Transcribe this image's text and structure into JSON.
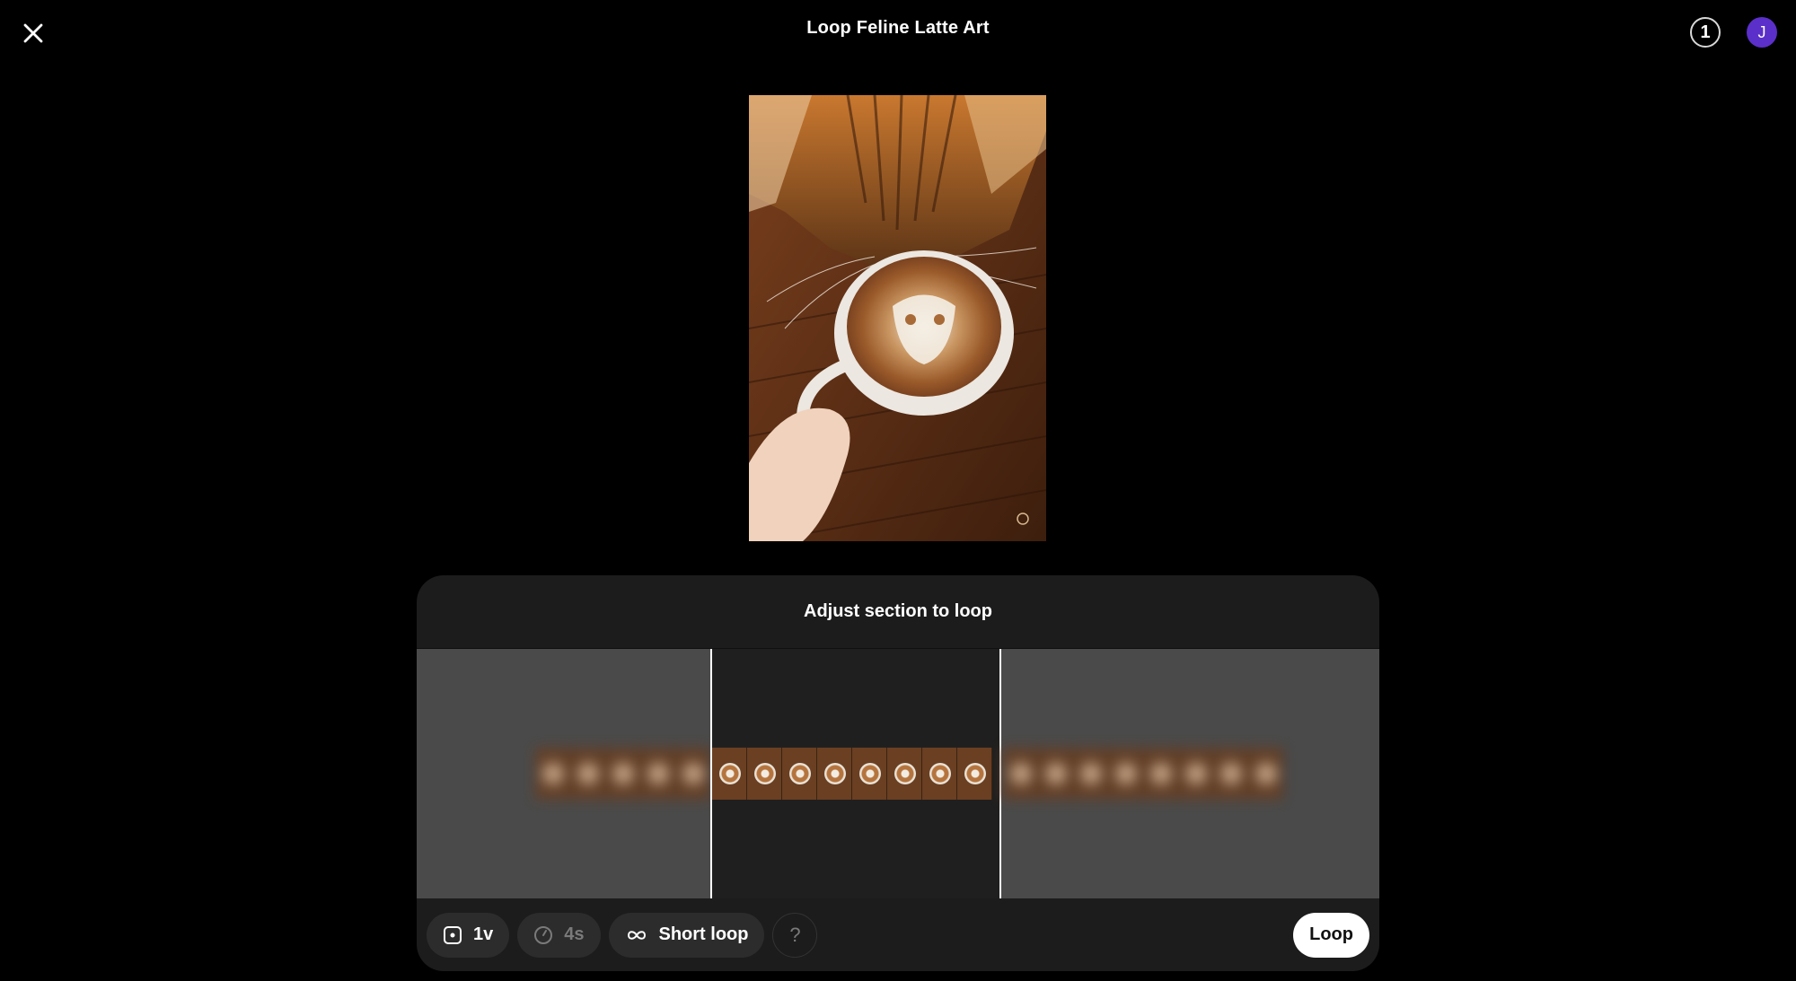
{
  "header": {
    "title": "Loop Feline Latte Art",
    "credits": "1",
    "avatar_initial": "J"
  },
  "panel": {
    "heading": "Adjust section to loop"
  },
  "toolbar": {
    "variations_label": "1v",
    "duration_label": "4s",
    "mode_label": "Short loop",
    "help_label": "?",
    "loop_button_label": "Loop"
  },
  "colors": {
    "avatar": "#5b2fc9",
    "background": "#000000",
    "panel": "#1c1c1c"
  },
  "icons": {
    "close": "close-icon",
    "variations": "square-dot-icon",
    "duration": "clock-icon",
    "mode": "infinity-icon"
  }
}
